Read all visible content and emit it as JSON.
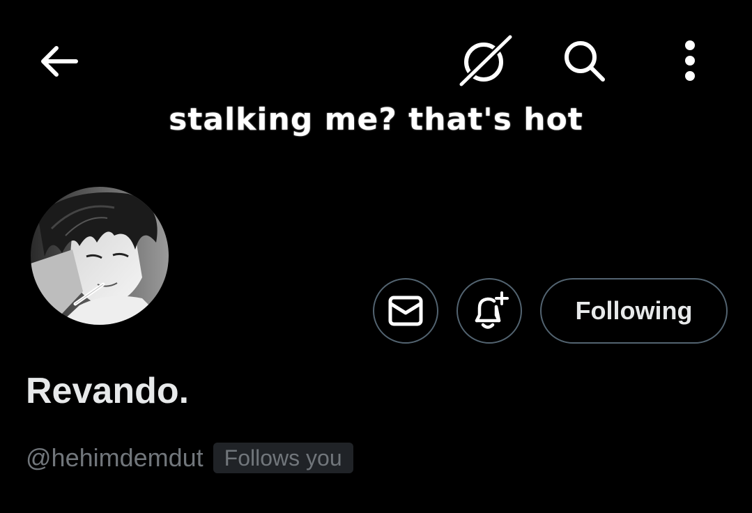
{
  "header": {
    "back_icon": "arrow-left-icon",
    "grok_icon": "grok-icon",
    "search_icon": "search-icon",
    "more_icon": "more-vertical-icon"
  },
  "banner": {
    "text": "stalking me? that's hot"
  },
  "profile": {
    "avatar": "avatar",
    "display_name": "Revando.",
    "handle": "@hehimdemdut",
    "follows_you_label": "Follows you"
  },
  "actions": {
    "message_icon": "mail-icon",
    "notify_icon": "bell-plus-icon",
    "following_label": "Following"
  },
  "colors": {
    "background": "#000000",
    "text_primary": "#e7e9ea",
    "text_secondary": "#71767b",
    "border": "#536471",
    "badge_bg": "#202327"
  }
}
